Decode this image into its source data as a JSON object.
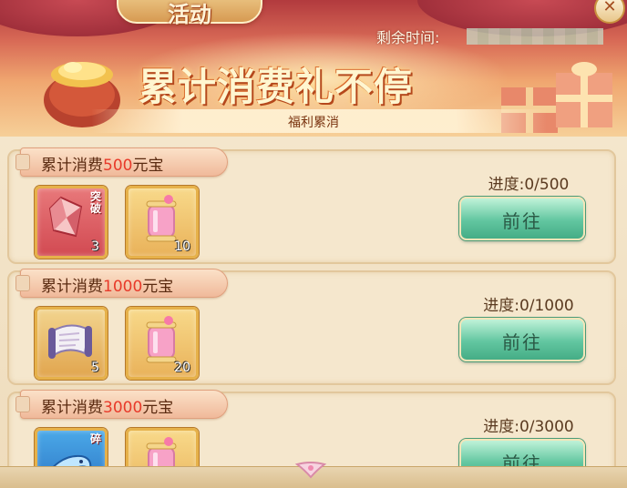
{
  "header": {
    "panel_title": "活动",
    "close_label": "✕",
    "remaining_label": "剩余时间:",
    "headline": "累计消费礼不停",
    "subtitle": "福利累消"
  },
  "tasks": [
    {
      "title_prefix": "累计消费",
      "amount": "500",
      "title_suffix": "元宝",
      "progress": "进度:0/500",
      "button": "前往",
      "rewards": [
        {
          "icon": "breakthrough-crystal-icon",
          "tag": "突破",
          "count": "3"
        },
        {
          "icon": "potion-scroll-icon",
          "count": "10"
        }
      ]
    },
    {
      "title_prefix": "累计消费",
      "amount": "1000",
      "title_suffix": "元宝",
      "progress": "进度:0/1000",
      "button": "前往",
      "rewards": [
        {
          "icon": "scroll-icon",
          "count": "5"
        },
        {
          "icon": "potion-scroll-icon",
          "count": "20"
        }
      ]
    },
    {
      "title_prefix": "累计消费",
      "amount": "3000",
      "title_suffix": "元宝",
      "progress": "进度:0/3000",
      "button": "前往",
      "rewards": [
        {
          "icon": "dragon-fragment-icon",
          "tag": "碎"
        },
        {
          "icon": "potion-scroll-icon"
        }
      ]
    }
  ],
  "colors": {
    "amount_red": "#e83a2a",
    "button_green": "#62c6a0",
    "card_bg": "#f5e7cd"
  }
}
